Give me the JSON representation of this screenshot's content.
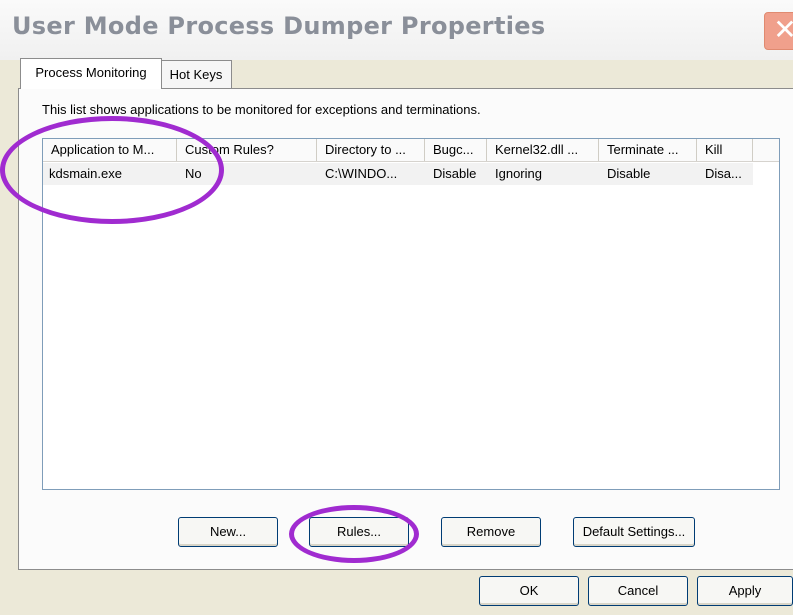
{
  "window": {
    "title": "User Mode Process Dumper Properties",
    "close_glyph": "✕"
  },
  "tabs": [
    {
      "label": "Process Monitoring",
      "active": true
    },
    {
      "label": "Hot Keys",
      "active": false
    }
  ],
  "description": "This list shows applications to be monitored for exceptions and terminations.",
  "list": {
    "columns": [
      "Application to M...",
      "Custom Rules?",
      "Directory to ...",
      "Bugc...",
      "Kernel32.dll ...",
      "Terminate ...",
      "Kill"
    ],
    "rows": [
      [
        "kdsmain.exe",
        "No",
        "C:\\WINDO...",
        "Disable",
        "Ignoring",
        "Disable",
        "Disa..."
      ]
    ]
  },
  "panel_buttons": {
    "new": "New...",
    "rules": "Rules...",
    "remove": "Remove",
    "default_settings": "Default Settings..."
  },
  "dialog_buttons": {
    "ok": "OK",
    "cancel": "Cancel",
    "apply": "Apply"
  },
  "colors": {
    "annotation": "#a02bd0",
    "dialog_bg": "#ece9d8",
    "title_text": "#8a8f99"
  }
}
